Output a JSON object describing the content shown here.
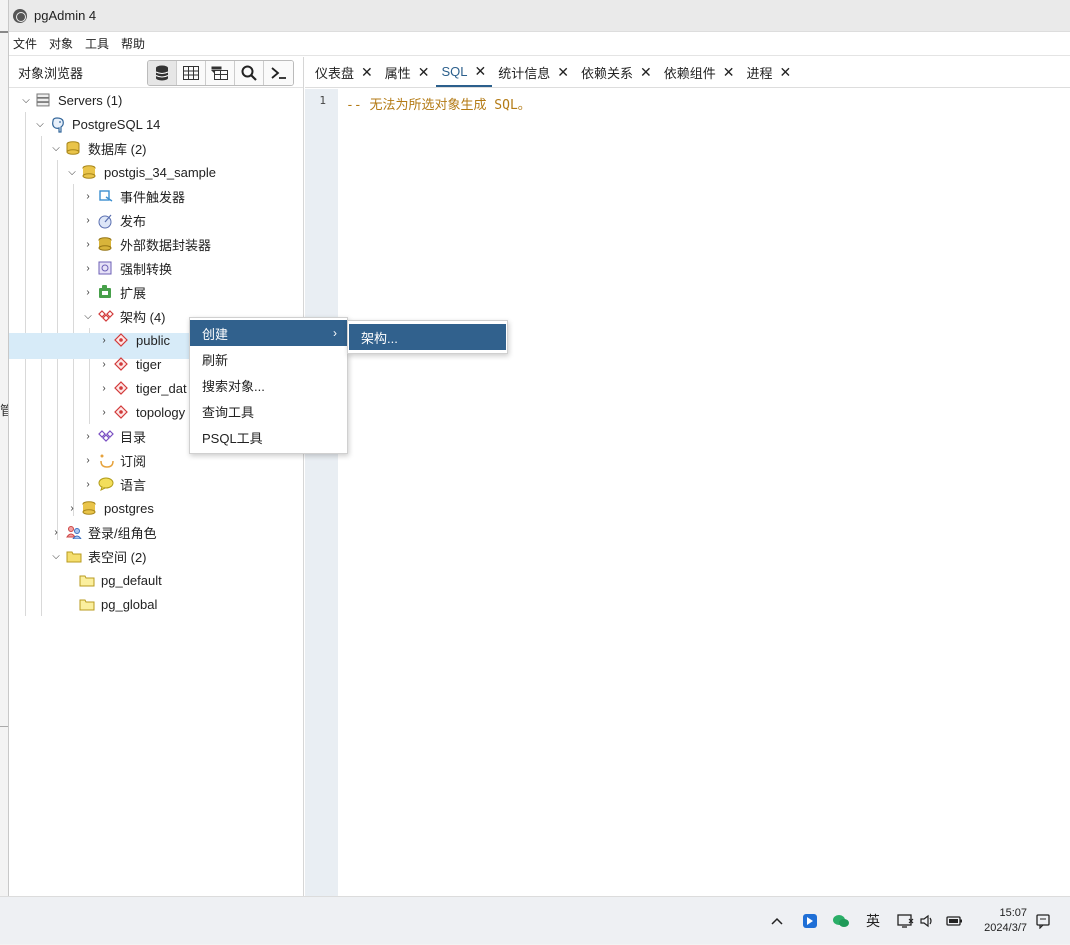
{
  "window": {
    "title": "pgAdmin 4"
  },
  "menubar": {
    "items": [
      "文件",
      "对象",
      "工具",
      "帮助"
    ]
  },
  "object_browser": {
    "title": "对象浏览器",
    "toolbar_icons": [
      "database-icon",
      "table-grid-icon",
      "filter-table-icon",
      "search-icon",
      "terminal-icon"
    ]
  },
  "tree": {
    "servers": "Servers (1)",
    "server": "PostgreSQL 14",
    "databases": "数据库 (2)",
    "db1": "postgis_34_sample",
    "event_triggers": "事件触发器",
    "publications": "发布",
    "fdw": "外部数据封装器",
    "casts": "强制转换",
    "extensions": "扩展",
    "schemas": "架构 (4)",
    "schema_public": "public",
    "schema_tiger": "tiger",
    "schema_tiger_data": "tiger_dat",
    "schema_topology": "topology",
    "catalogs": "目录",
    "subscriptions": "订阅",
    "languages": "语言",
    "db2": "postgres",
    "login_roles": "登录/组角色",
    "tablespaces": "表空间 (2)",
    "ts1": "pg_default",
    "ts2": "pg_global"
  },
  "tabs": [
    {
      "label": "仪表盘",
      "active": false
    },
    {
      "label": "属性",
      "active": false
    },
    {
      "label": "SQL",
      "active": true
    },
    {
      "label": "统计信息",
      "active": false
    },
    {
      "label": "依赖关系",
      "active": false
    },
    {
      "label": "依赖组件",
      "active": false
    },
    {
      "label": "进程",
      "active": false
    }
  ],
  "tab_close_glyph": "✕",
  "editor": {
    "line_number": "1",
    "code": "-- 无法为所选对象生成 SQL。"
  },
  "context_menu": {
    "items": [
      "创建",
      "刷新",
      "搜索对象...",
      "查询工具",
      "PSQL工具"
    ],
    "submenu_arrow": "›",
    "submenu": [
      "架构..."
    ]
  },
  "taskbar": {
    "ime": "英",
    "time": "15:07",
    "date": "2024/3/7"
  },
  "edge_fragment": "管",
  "colors": {
    "accent": "#31618d",
    "selection": "#d7ebf8",
    "code": "#b37a14"
  }
}
